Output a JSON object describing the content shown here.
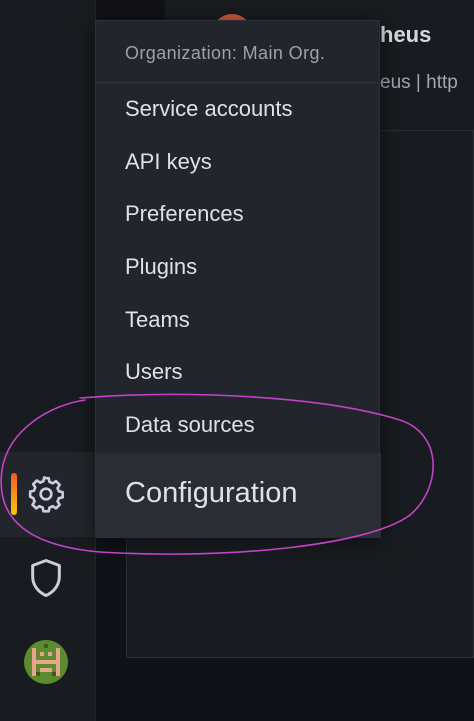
{
  "header": {
    "title": "heus",
    "subtitle": "eus  |  http"
  },
  "menu": {
    "header": "Organization: Main Org.",
    "items": [
      {
        "label": "Service accounts"
      },
      {
        "label": "API keys"
      },
      {
        "label": "Preferences"
      },
      {
        "label": "Plugins"
      },
      {
        "label": "Teams"
      },
      {
        "label": "Users"
      },
      {
        "label": "Data sources"
      }
    ],
    "title": "Configuration"
  },
  "sidebar": {
    "icons": [
      "gear-icon",
      "shield-icon"
    ],
    "active_item": "configuration",
    "accent_gradient": [
      "#f05a28",
      "#fbca0a"
    ]
  },
  "annotation": {
    "shape": "hand-drawn ellipse",
    "color": "#c243c9"
  }
}
